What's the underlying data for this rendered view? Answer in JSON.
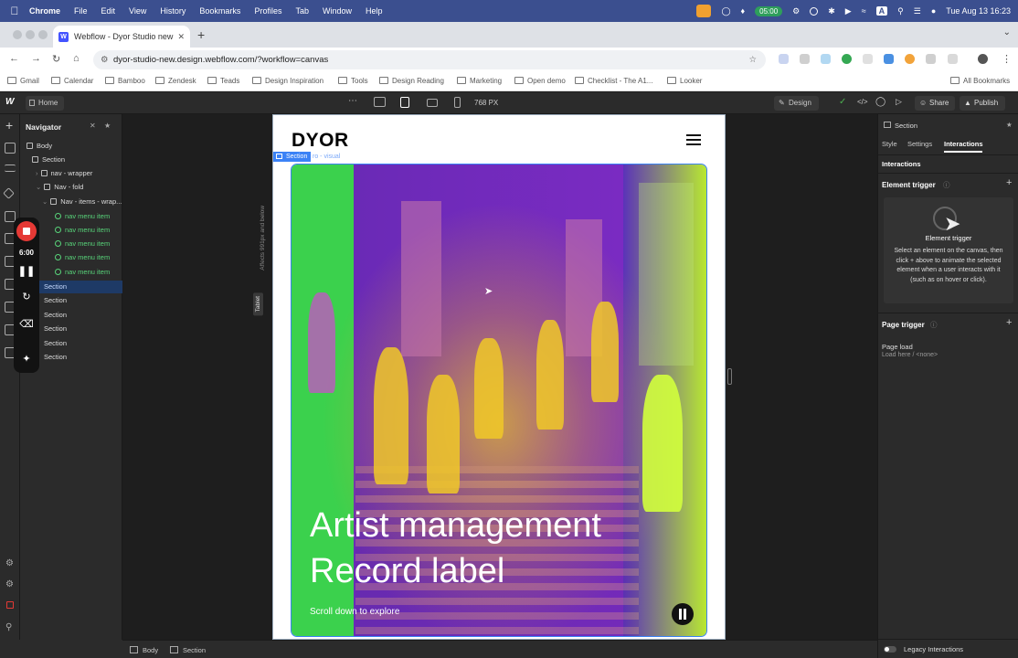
{
  "menubar": {
    "app": "Chrome",
    "items": [
      "File",
      "Edit",
      "View",
      "History",
      "Bookmarks",
      "Profiles",
      "Tab",
      "Window",
      "Help"
    ],
    "timer": "05:00",
    "datetime": "Tue Aug 13  16:23"
  },
  "browser": {
    "tab_title": "Webflow - Dyor Studio new",
    "url": "dyor-studio-new.design.webflow.com/?workflow=canvas",
    "bookmarks": [
      "Gmail",
      "Calendar",
      "Bamboo",
      "Zendesk",
      "Teads",
      "Design Inspiration",
      "Tools",
      "Design Reading",
      "Marketing",
      "Open demo",
      "Checklist - The A1...",
      "Looker"
    ],
    "all_bookmarks": "All Bookmarks"
  },
  "webflow": {
    "home": "Home",
    "width_label": "768 PX",
    "design": "Design",
    "share": "Share",
    "publish": "Publish"
  },
  "navigator": {
    "title": "Navigator",
    "rows": [
      {
        "label": "Body"
      },
      {
        "label": "Section"
      },
      {
        "label": "nav - wrapper"
      },
      {
        "label": "Nav - fold"
      },
      {
        "label": "Nav - items - wrap..."
      },
      {
        "label": "nav menu item"
      },
      {
        "label": "nav menu item"
      },
      {
        "label": "nav menu item"
      },
      {
        "label": "nav menu item"
      },
      {
        "label": "nav menu item"
      },
      {
        "label": "Section"
      },
      {
        "label": "Section"
      },
      {
        "label": "Section"
      },
      {
        "label": "Section"
      },
      {
        "label": "Section"
      },
      {
        "label": "Section"
      }
    ]
  },
  "recorder": {
    "time": "6:00"
  },
  "canvas": {
    "breakpoint_note": "Affects 991px and below",
    "breakpoint_badge": "Tablet",
    "selected_label": "Section",
    "selected_class": "ro - visual",
    "brand": "DYOR",
    "headline_1": "Artist management",
    "headline_2": "Record label",
    "scroll_cue": "Scroll down to explore"
  },
  "rightpanel": {
    "element": "Section",
    "tabs": [
      "Style",
      "Settings",
      "Interactions"
    ],
    "section_title": "Interactions",
    "element_trigger": "Element trigger",
    "card_title": "Element trigger",
    "card_desc": "Select an element on the canvas, then click + above to animate the selected element when a user interacts with it (such as on hover or click).",
    "page_trigger": "Page trigger",
    "page_load": "Page load",
    "page_load_sub": "Load here / <none>",
    "legacy": "Legacy Interactions"
  },
  "bottombar": {
    "crumbs": [
      "Body",
      "Section"
    ]
  },
  "colors": {
    "menubar": "#3b4f8f",
    "webflow_panel": "#2b2b2b",
    "selection_blue": "#3b82f6",
    "navigator_green": "#58d57a",
    "hero_purple": "#7a2bc2",
    "hero_green": "#3bd14d",
    "hero_lime": "#b8e832"
  }
}
